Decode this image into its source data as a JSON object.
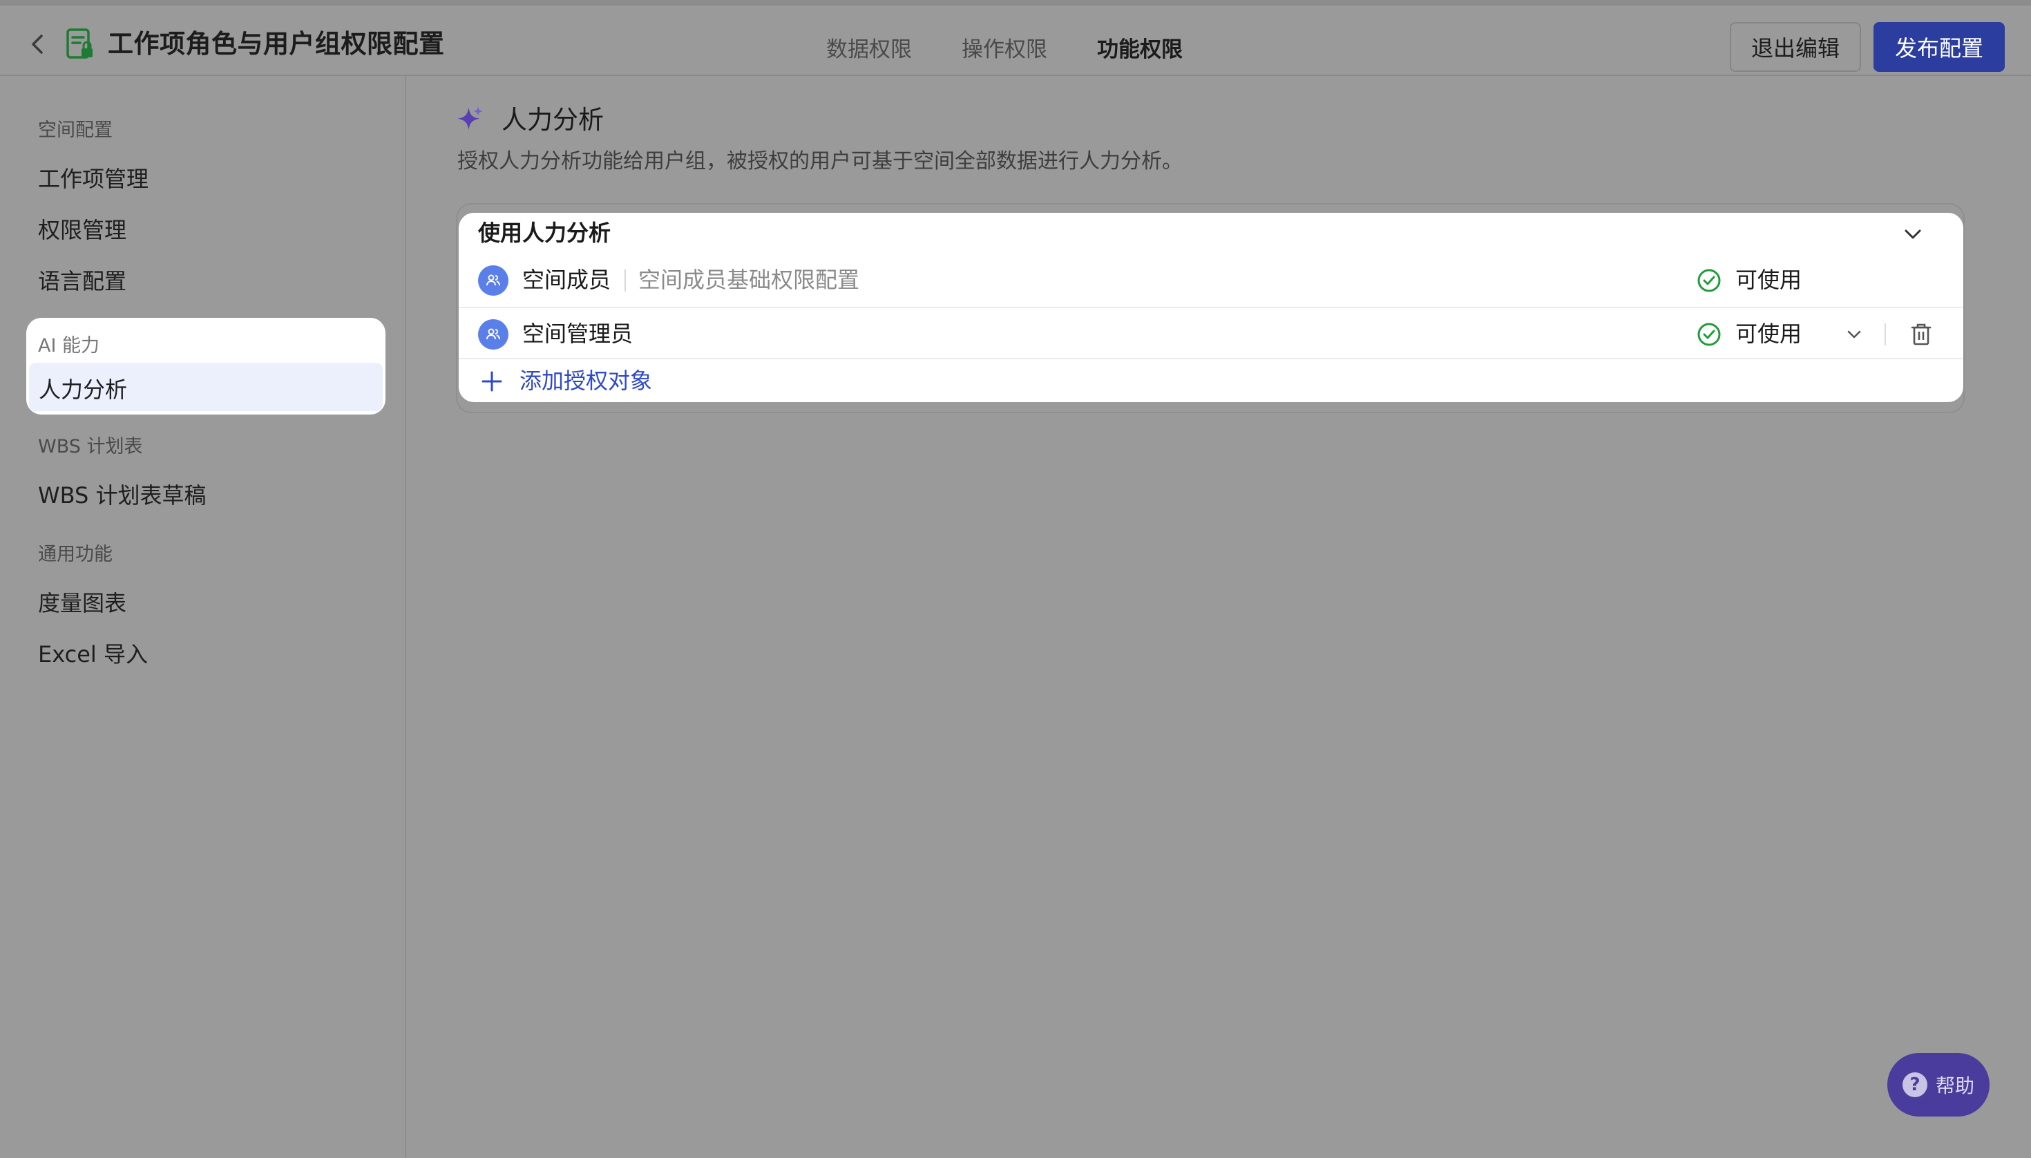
{
  "header": {
    "title": "工作项角色与用户组权限配置",
    "tabs": [
      {
        "label": "数据权限",
        "active": false
      },
      {
        "label": "操作权限",
        "active": false
      },
      {
        "label": "功能权限",
        "active": true
      }
    ],
    "exit_label": "退出编辑",
    "publish_label": "发布配置"
  },
  "sidebar": {
    "sections": [
      {
        "label": "空间配置",
        "items": [
          "工作项管理",
          "权限管理",
          "语言配置"
        ]
      },
      {
        "label": "AI 能力",
        "items": [
          "人力分析"
        ]
      },
      {
        "label": "WBS 计划表",
        "items": [
          "WBS 计划表草稿"
        ]
      },
      {
        "label": "通用功能",
        "items": [
          "度量图表",
          "Excel 导入"
        ]
      }
    ],
    "active_item": "人力分析"
  },
  "main": {
    "title": "人力分析",
    "description": "授权人力分析功能给用户组，被授权的用户可基于空间全部数据进行人力分析。",
    "card": {
      "title": "使用人力分析",
      "rows": [
        {
          "name": "空间成员",
          "desc": "空间成员基础权限配置",
          "status": "可使用"
        },
        {
          "name": "空间管理员",
          "desc": "",
          "status": "可使用"
        }
      ],
      "add_label": "添加授权对象"
    }
  },
  "help": {
    "label": "帮助",
    "icon": "?"
  },
  "colors": {
    "primary": "#2b3d9e",
    "link": "#2f49c7",
    "success": "#1f9d3a",
    "avatar": "#5b7fe8",
    "overlay": "#9a9a9a"
  }
}
